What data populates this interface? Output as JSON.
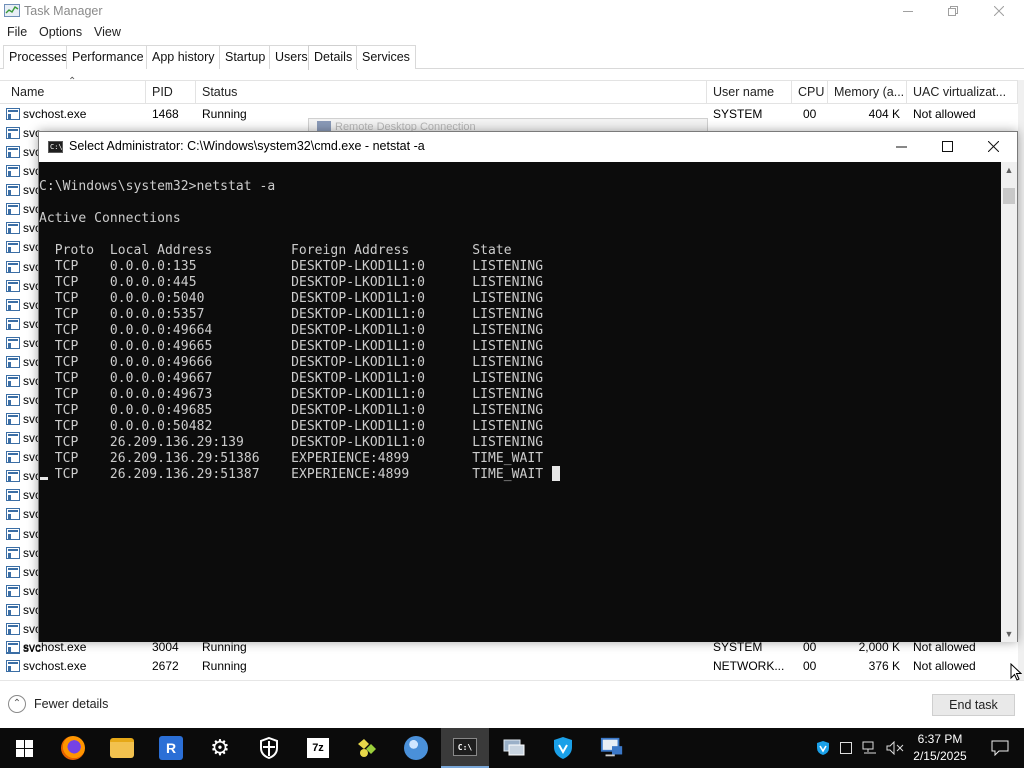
{
  "task_manager": {
    "title": "Task Manager",
    "menu": [
      "File",
      "Options",
      "View"
    ],
    "tabs": [
      "Processes",
      "Performance",
      "App history",
      "Startup",
      "Users",
      "Details",
      "Services"
    ],
    "active_tab": "Details",
    "columns": {
      "name": "Name",
      "pid": "PID",
      "status": "Status",
      "user": "User name",
      "cpu": "CPU",
      "memory": "Memory (a...",
      "uac": "UAC virtualizat..."
    },
    "rows": [
      {
        "name": "svchost.exe",
        "pid": "1468",
        "status": "Running",
        "user": "SYSTEM",
        "cpu": "00",
        "memory": "404 K",
        "uac": "Not allowed"
      },
      {
        "name": "svc"
      },
      {
        "name": "svc"
      },
      {
        "name": "svc"
      },
      {
        "name": "svc"
      },
      {
        "name": "svc"
      },
      {
        "name": "svc"
      },
      {
        "name": "svc"
      },
      {
        "name": "svc"
      },
      {
        "name": "svc"
      },
      {
        "name": "svc"
      },
      {
        "name": "svc"
      },
      {
        "name": "svc"
      },
      {
        "name": "svc"
      },
      {
        "name": "svc"
      },
      {
        "name": "svc"
      },
      {
        "name": "svc"
      },
      {
        "name": "svc"
      },
      {
        "name": "svc"
      },
      {
        "name": "svc"
      },
      {
        "name": "svc"
      },
      {
        "name": "svc"
      },
      {
        "name": "svc"
      },
      {
        "name": "svc"
      },
      {
        "name": "svc"
      },
      {
        "name": "svc"
      },
      {
        "name": "svc"
      },
      {
        "name": "svc"
      },
      {
        "name": "svc"
      },
      {
        "name": "svchost.exe",
        "pid": "3004",
        "status": "Running",
        "user": "SYSTEM",
        "cpu": "00",
        "memory": "2,000 K",
        "uac": "Not allowed"
      },
      {
        "name": "svchost.exe",
        "pid": "2672",
        "status": "Running",
        "user": "NETWORK...",
        "cpu": "00",
        "memory": "376 K",
        "uac": "Not allowed"
      }
    ],
    "fewer_details": "Fewer details",
    "end_task": "End task"
  },
  "background_window": {
    "title": "Remote Desktop Connection"
  },
  "cmd": {
    "title": "Select Administrator: C:\\Windows\\system32\\cmd.exe - netstat  -a",
    "prompt_line": "C:\\Windows\\system32>netstat -a",
    "heading": "Active Connections",
    "columns": [
      "Proto",
      "Local Address",
      "Foreign Address",
      "State"
    ],
    "connections": [
      [
        "TCP",
        "0.0.0.0:135",
        "DESKTOP-LKOD1L1:0",
        "LISTENING"
      ],
      [
        "TCP",
        "0.0.0.0:445",
        "DESKTOP-LKOD1L1:0",
        "LISTENING"
      ],
      [
        "TCP",
        "0.0.0.0:5040",
        "DESKTOP-LKOD1L1:0",
        "LISTENING"
      ],
      [
        "TCP",
        "0.0.0.0:5357",
        "DESKTOP-LKOD1L1:0",
        "LISTENING"
      ],
      [
        "TCP",
        "0.0.0.0:49664",
        "DESKTOP-LKOD1L1:0",
        "LISTENING"
      ],
      [
        "TCP",
        "0.0.0.0:49665",
        "DESKTOP-LKOD1L1:0",
        "LISTENING"
      ],
      [
        "TCP",
        "0.0.0.0:49666",
        "DESKTOP-LKOD1L1:0",
        "LISTENING"
      ],
      [
        "TCP",
        "0.0.0.0:49667",
        "DESKTOP-LKOD1L1:0",
        "LISTENING"
      ],
      [
        "TCP",
        "0.0.0.0:49673",
        "DESKTOP-LKOD1L1:0",
        "LISTENING"
      ],
      [
        "TCP",
        "0.0.0.0:49685",
        "DESKTOP-LKOD1L1:0",
        "LISTENING"
      ],
      [
        "TCP",
        "0.0.0.0:50482",
        "DESKTOP-LKOD1L1:0",
        "LISTENING"
      ],
      [
        "TCP",
        "26.209.136.29:139",
        "DESKTOP-LKOD1L1:0",
        "LISTENING"
      ],
      [
        "TCP",
        "26.209.136.29:51386",
        "EXPERIENCE:4899",
        "TIME_WAIT"
      ],
      [
        "TCP",
        "26.209.136.29:51387",
        "EXPERIENCE:4899",
        "TIME_WAIT"
      ]
    ]
  },
  "taskbar": {
    "apps": [
      {
        "icon": "firefox-icon",
        "color": "#e66000"
      },
      {
        "icon": "file-explorer-icon",
        "color": "#f2c14e"
      },
      {
        "icon": "remote-app-icon",
        "color": "#2b6fd6"
      },
      {
        "icon": "settings-gear-icon",
        "color": "#ffffff"
      },
      {
        "icon": "shield-app-icon",
        "color": "#ffffff"
      },
      {
        "icon": "7zip-icon",
        "color": "#ffffff"
      },
      {
        "icon": "puzzle-app-icon",
        "color": "#e8d84a"
      },
      {
        "icon": "globe-browser-icon",
        "color": "#4a90d9"
      },
      {
        "icon": "command-prompt-icon",
        "color": "#1e1e1e"
      },
      {
        "icon": "network-monitor-icon",
        "color": "#9ab0c8"
      },
      {
        "icon": "vpn-shield-icon",
        "color": "#1aa0e8"
      },
      {
        "icon": "remote-desktop-icon",
        "color": "#3b78c8"
      }
    ],
    "time": "6:37 PM",
    "date": "2/15/2025"
  }
}
